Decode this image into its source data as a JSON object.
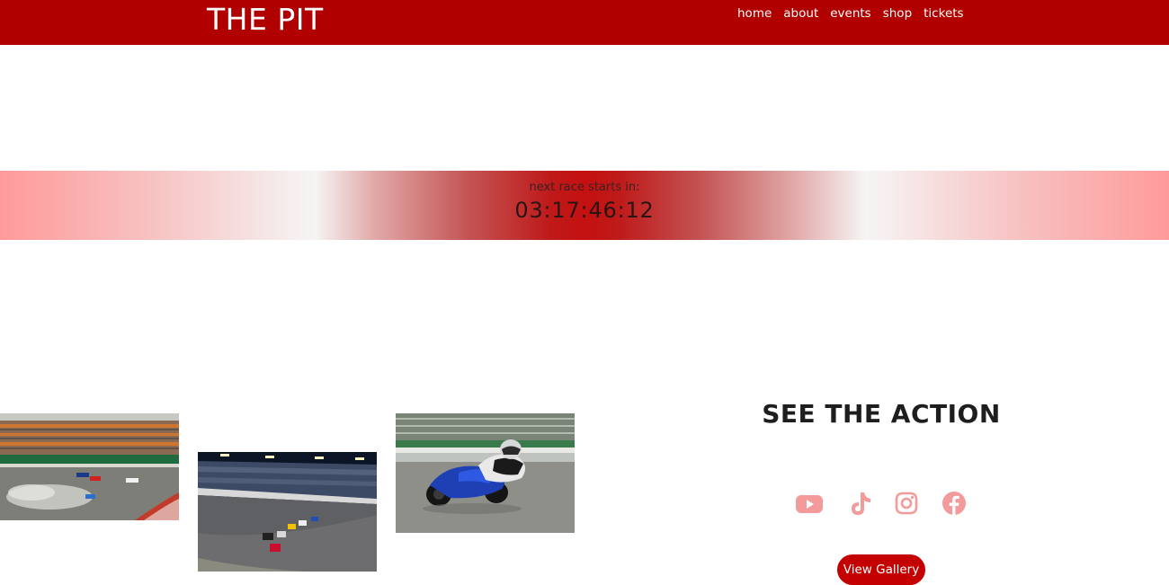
{
  "header": {
    "brand": "THE PIT",
    "nav": [
      "home",
      "about",
      "events",
      "shop",
      "tickets"
    ]
  },
  "countdown": {
    "label": "next race starts in:",
    "time": "03:17:46:12"
  },
  "gallery": {
    "heading": "SEE THE ACTION",
    "button_label": "View Gallery",
    "photos": [
      {
        "name": "f1-grandstand-crash-photo"
      },
      {
        "name": "stock-car-night-race-photo"
      },
      {
        "name": "blue-motorcycle-lean-photo"
      }
    ]
  },
  "social": {
    "icons": [
      "youtube-icon",
      "tiktok-icon",
      "instagram-icon",
      "facebook-icon"
    ],
    "color": "#f39a9a"
  },
  "colors": {
    "brand_red": "#b00000",
    "button_red": "#c40000"
  }
}
